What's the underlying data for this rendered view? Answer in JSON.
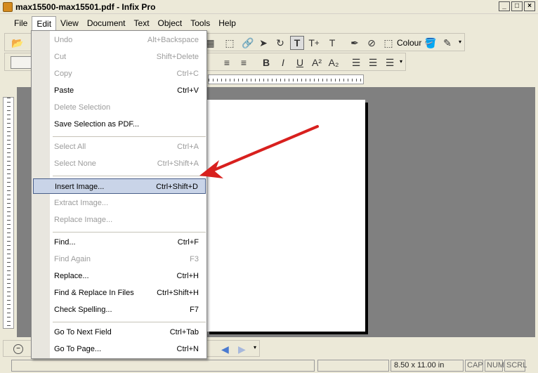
{
  "window": {
    "title": "max15500-max15501.pdf - Infix Pro",
    "controls": [
      "_",
      "□",
      "×"
    ]
  },
  "menubar": [
    "File",
    "Edit",
    "View",
    "Document",
    "Text",
    "Object",
    "Tools",
    "Help"
  ],
  "toolbar": {
    "colour_label": "Colour"
  },
  "edit_menu": {
    "items": [
      {
        "label": "Undo",
        "shortcut": "Alt+Backspace",
        "enabled": false
      },
      {
        "label": "Cut",
        "shortcut": "Shift+Delete",
        "enabled": false
      },
      {
        "label": "Copy",
        "shortcut": "Ctrl+C",
        "enabled": false
      },
      {
        "label": "Paste",
        "shortcut": "Ctrl+V",
        "enabled": true
      },
      {
        "label": "Delete Selection",
        "shortcut": "",
        "enabled": false
      },
      {
        "label": "Save Selection as PDF...",
        "shortcut": "",
        "enabled": true
      },
      {
        "label": "Select All",
        "shortcut": "Ctrl+A",
        "enabled": false
      },
      {
        "label": "Select None",
        "shortcut": "Ctrl+Shift+A",
        "enabled": false
      },
      {
        "label": "Insert Image...",
        "shortcut": "Ctrl+Shift+D",
        "enabled": true,
        "highlighted": true
      },
      {
        "label": "Extract Image...",
        "shortcut": "",
        "enabled": false
      },
      {
        "label": "Replace Image...",
        "shortcut": "",
        "enabled": false
      },
      {
        "label": "Find...",
        "shortcut": "Ctrl+F",
        "enabled": true
      },
      {
        "label": "Find Again",
        "shortcut": "F3",
        "enabled": false
      },
      {
        "label": "Replace...",
        "shortcut": "Ctrl+H",
        "enabled": true
      },
      {
        "label": "Find & Replace In Files",
        "shortcut": "Ctrl+Shift+H",
        "enabled": true
      },
      {
        "label": "Check Spelling...",
        "shortcut": "F7",
        "enabled": true
      },
      {
        "label": "Go To Next Field",
        "shortcut": "Ctrl+Tab",
        "enabled": true
      },
      {
        "label": "Go To Page...",
        "shortcut": "Ctrl+N",
        "enabled": true
      }
    ]
  },
  "statusbar": {
    "page_size": "8.50 x 11.00 in",
    "caps": "CAP",
    "num": "NUM",
    "scrl": "SCRL"
  },
  "colors": {
    "highlight_bg": "#c9d4e8",
    "highlight_border": "#4a5f8a",
    "annotation_arrow": "#d8201e",
    "workspace": "#808080"
  }
}
